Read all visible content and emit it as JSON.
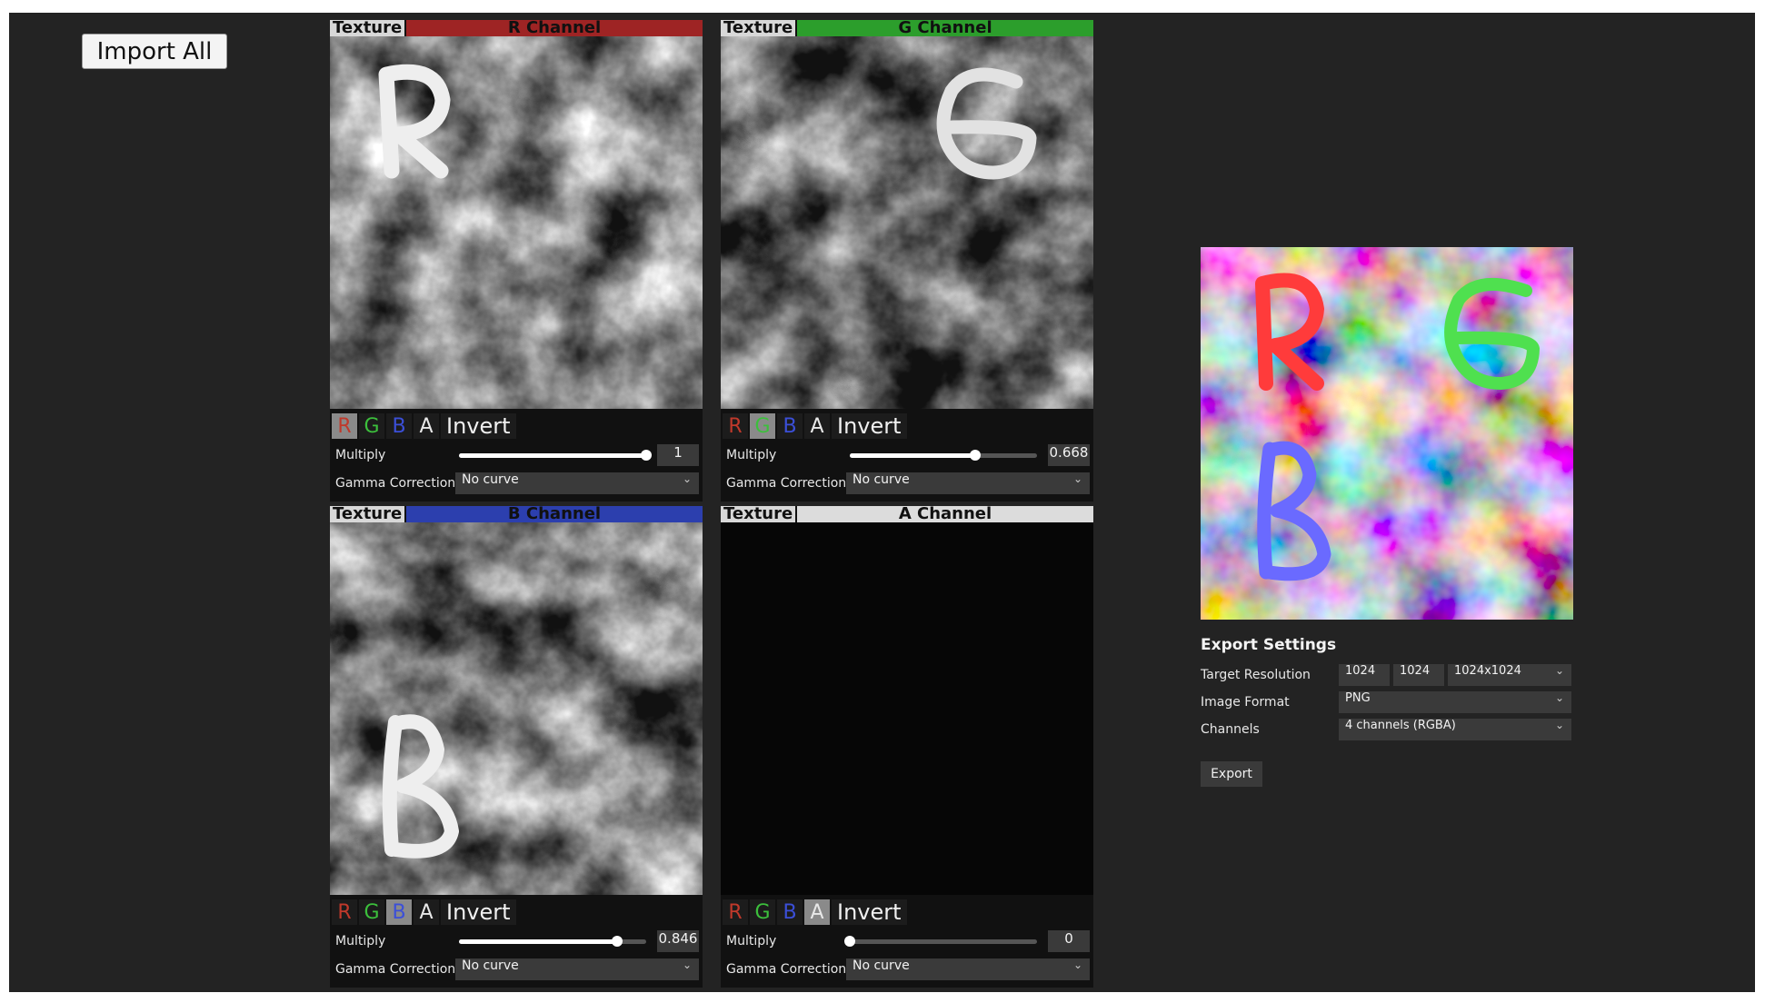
{
  "toolbar": {
    "import_all_label": "Import All"
  },
  "panels": {
    "r": {
      "texture_label": "Texture",
      "channel_label": "R Channel",
      "header_color": "#9e2424",
      "letter": "R",
      "toggles": [
        "R",
        "G",
        "B",
        "A"
      ],
      "active_toggle": "R",
      "invert_label": "Invert",
      "multiply_label": "Multiply",
      "multiply_value": "1",
      "multiply_level": 1.0,
      "gamma_label": "Gamma Correction",
      "gamma_value": "No curve"
    },
    "g": {
      "texture_label": "Texture",
      "channel_label": "G Channel",
      "header_color": "#2c9e2c",
      "letter": "G",
      "toggles": [
        "R",
        "G",
        "B",
        "A"
      ],
      "active_toggle": "G",
      "invert_label": "Invert",
      "multiply_label": "Multiply",
      "multiply_value": "0.668",
      "multiply_level": 0.668,
      "gamma_label": "Gamma Correction",
      "gamma_value": "No curve"
    },
    "b": {
      "texture_label": "Texture",
      "channel_label": "B Channel",
      "header_color": "#2c3fae",
      "letter": "B",
      "toggles": [
        "R",
        "G",
        "B",
        "A"
      ],
      "active_toggle": "B",
      "invert_label": "Invert",
      "multiply_label": "Multiply",
      "multiply_value": "0.846",
      "multiply_level": 0.846,
      "gamma_label": "Gamma Correction",
      "gamma_value": "No curve"
    },
    "a": {
      "texture_label": "Texture",
      "channel_label": "A Channel",
      "header_color": "#dcdcdc",
      "letter": "",
      "toggles": [
        "R",
        "G",
        "B",
        "A"
      ],
      "active_toggle": "A",
      "invert_label": "Invert",
      "multiply_label": "Multiply",
      "multiply_value": "0",
      "multiply_level": 0.0,
      "gamma_label": "Gamma Correction",
      "gamma_value": "No curve"
    }
  },
  "export": {
    "title": "Export Settings",
    "target_resolution_label": "Target Resolution",
    "width": "1024",
    "height": "1024",
    "preset": "1024x1024",
    "image_format_label": "Image Format",
    "image_format": "PNG",
    "channels_label": "Channels",
    "channels": "4 channels (RGBA)",
    "export_label": "Export"
  }
}
